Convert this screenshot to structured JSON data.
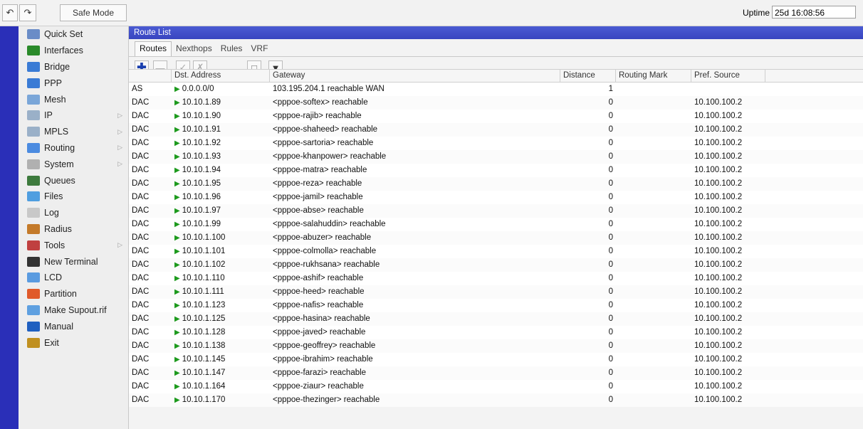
{
  "toolbar": {
    "undo_icon": "undo-icon",
    "redo_icon": "redo-icon",
    "safe_mode_label": "Safe Mode",
    "uptime_label": "Uptime",
    "uptime_value": "25d 16:08:56"
  },
  "sidebar": {
    "items": [
      {
        "label": "Quick Set",
        "icon": "quick-set-icon",
        "color": "#6a8cc7",
        "submenu": false
      },
      {
        "label": "Interfaces",
        "icon": "interfaces-icon",
        "color": "#2a8a2a",
        "submenu": false
      },
      {
        "label": "Bridge",
        "icon": "bridge-icon",
        "color": "#3a7bd5",
        "submenu": false
      },
      {
        "label": "PPP",
        "icon": "ppp-icon",
        "color": "#3a7bd5",
        "submenu": false
      },
      {
        "label": "Mesh",
        "icon": "mesh-icon",
        "color": "#7aa6d8",
        "submenu": false
      },
      {
        "label": "IP",
        "icon": "ip-icon",
        "color": "#9ab0c8",
        "submenu": true
      },
      {
        "label": "MPLS",
        "icon": "mpls-icon",
        "color": "#9ab0c8",
        "submenu": true
      },
      {
        "label": "Routing",
        "icon": "routing-icon",
        "color": "#4b8be0",
        "submenu": true
      },
      {
        "label": "System",
        "icon": "system-icon",
        "color": "#b0b0b0",
        "submenu": true
      },
      {
        "label": "Queues",
        "icon": "queues-icon",
        "color": "#3d7a3d",
        "submenu": false
      },
      {
        "label": "Files",
        "icon": "files-icon",
        "color": "#4f9ee0",
        "submenu": false
      },
      {
        "label": "Log",
        "icon": "log-icon",
        "color": "#c8c8c8",
        "submenu": false
      },
      {
        "label": "Radius",
        "icon": "radius-icon",
        "color": "#c47a2a",
        "submenu": false
      },
      {
        "label": "Tools",
        "icon": "tools-icon",
        "color": "#c04040",
        "submenu": true
      },
      {
        "label": "New Terminal",
        "icon": "terminal-icon",
        "color": "#333333",
        "submenu": false
      },
      {
        "label": "LCD",
        "icon": "lcd-icon",
        "color": "#5a9be0",
        "submenu": false
      },
      {
        "label": "Partition",
        "icon": "partition-icon",
        "color": "#e05a2a",
        "submenu": false
      },
      {
        "label": "Make Supout.rif",
        "icon": "supout-icon",
        "color": "#5fa0e0",
        "submenu": false
      },
      {
        "label": "Manual",
        "icon": "manual-icon",
        "color": "#2060c0",
        "submenu": false
      },
      {
        "label": "Exit",
        "icon": "exit-icon",
        "color": "#c09020",
        "submenu": false
      }
    ]
  },
  "window": {
    "title": "Route List",
    "tabs": [
      "Routes",
      "Nexthops",
      "Rules",
      "VRF"
    ],
    "active_tab": "Routes",
    "actions": [
      "add-icon",
      "remove-icon",
      "enable-icon",
      "disable-icon",
      "comment-icon",
      "filter-icon"
    ]
  },
  "table": {
    "headers": {
      "flags": "",
      "dst": "Dst. Address",
      "gw": "Gateway",
      "dist": "Distance",
      "rm": "Routing Mark",
      "pref": "Pref. Source"
    },
    "rows": [
      {
        "flags": "AS",
        "dst": "0.0.0.0/0",
        "gw": "103.195.204.1 reachable WAN",
        "dist": "1",
        "rm": "",
        "pref": ""
      },
      {
        "flags": "DAC",
        "dst": "10.10.1.89",
        "gw": "<pppoe-softex> reachable",
        "dist": "0",
        "rm": "",
        "pref": "10.100.100.2"
      },
      {
        "flags": "DAC",
        "dst": "10.10.1.90",
        "gw": "<pppoe-rajib> reachable",
        "dist": "0",
        "rm": "",
        "pref": "10.100.100.2"
      },
      {
        "flags": "DAC",
        "dst": "10.10.1.91",
        "gw": "<pppoe-shaheed> reachable",
        "dist": "0",
        "rm": "",
        "pref": "10.100.100.2"
      },
      {
        "flags": "DAC",
        "dst": "10.10.1.92",
        "gw": "<pppoe-sartoria> reachable",
        "dist": "0",
        "rm": "",
        "pref": "10.100.100.2"
      },
      {
        "flags": "DAC",
        "dst": "10.10.1.93",
        "gw": "<pppoe-khanpower> reachable",
        "dist": "0",
        "rm": "",
        "pref": "10.100.100.2"
      },
      {
        "flags": "DAC",
        "dst": "10.10.1.94",
        "gw": "<pppoe-matra> reachable",
        "dist": "0",
        "rm": "",
        "pref": "10.100.100.2"
      },
      {
        "flags": "DAC",
        "dst": "10.10.1.95",
        "gw": "<pppoe-reza> reachable",
        "dist": "0",
        "rm": "",
        "pref": "10.100.100.2"
      },
      {
        "flags": "DAC",
        "dst": "10.10.1.96",
        "gw": "<pppoe-jamil> reachable",
        "dist": "0",
        "rm": "",
        "pref": "10.100.100.2"
      },
      {
        "flags": "DAC",
        "dst": "10.10.1.97",
        "gw": "<pppoe-abse> reachable",
        "dist": "0",
        "rm": "",
        "pref": "10.100.100.2"
      },
      {
        "flags": "DAC",
        "dst": "10.10.1.99",
        "gw": "<pppoe-salahuddin> reachable",
        "dist": "0",
        "rm": "",
        "pref": "10.100.100.2"
      },
      {
        "flags": "DAC",
        "dst": "10.10.1.100",
        "gw": "<pppoe-abuzer> reachable",
        "dist": "0",
        "rm": "",
        "pref": "10.100.100.2"
      },
      {
        "flags": "DAC",
        "dst": "10.10.1.101",
        "gw": "<pppoe-colmolla> reachable",
        "dist": "0",
        "rm": "",
        "pref": "10.100.100.2"
      },
      {
        "flags": "DAC",
        "dst": "10.10.1.102",
        "gw": "<pppoe-rukhsana> reachable",
        "dist": "0",
        "rm": "",
        "pref": "10.100.100.2"
      },
      {
        "flags": "DAC",
        "dst": "10.10.1.110",
        "gw": "<pppoe-ashif> reachable",
        "dist": "0",
        "rm": "",
        "pref": "10.100.100.2"
      },
      {
        "flags": "DAC",
        "dst": "10.10.1.111",
        "gw": "<pppoe-heed> reachable",
        "dist": "0",
        "rm": "",
        "pref": "10.100.100.2"
      },
      {
        "flags": "DAC",
        "dst": "10.10.1.123",
        "gw": "<pppoe-nafis> reachable",
        "dist": "0",
        "rm": "",
        "pref": "10.100.100.2"
      },
      {
        "flags": "DAC",
        "dst": "10.10.1.125",
        "gw": "<pppoe-hasina> reachable",
        "dist": "0",
        "rm": "",
        "pref": "10.100.100.2"
      },
      {
        "flags": "DAC",
        "dst": "10.10.1.128",
        "gw": "<pppoe-javed> reachable",
        "dist": "0",
        "rm": "",
        "pref": "10.100.100.2"
      },
      {
        "flags": "DAC",
        "dst": "10.10.1.138",
        "gw": "<pppoe-geoffrey> reachable",
        "dist": "0",
        "rm": "",
        "pref": "10.100.100.2"
      },
      {
        "flags": "DAC",
        "dst": "10.10.1.145",
        "gw": "<pppoe-ibrahim> reachable",
        "dist": "0",
        "rm": "",
        "pref": "10.100.100.2"
      },
      {
        "flags": "DAC",
        "dst": "10.10.1.147",
        "gw": "<pppoe-farazi> reachable",
        "dist": "0",
        "rm": "",
        "pref": "10.100.100.2"
      },
      {
        "flags": "DAC",
        "dst": "10.10.1.164",
        "gw": "<pppoe-ziaur> reachable",
        "dist": "0",
        "rm": "",
        "pref": "10.100.100.2"
      },
      {
        "flags": "DAC",
        "dst": "10.10.1.170",
        "gw": "<pppoe-thezinger> reachable",
        "dist": "0",
        "rm": "",
        "pref": "10.100.100.2"
      }
    ]
  }
}
